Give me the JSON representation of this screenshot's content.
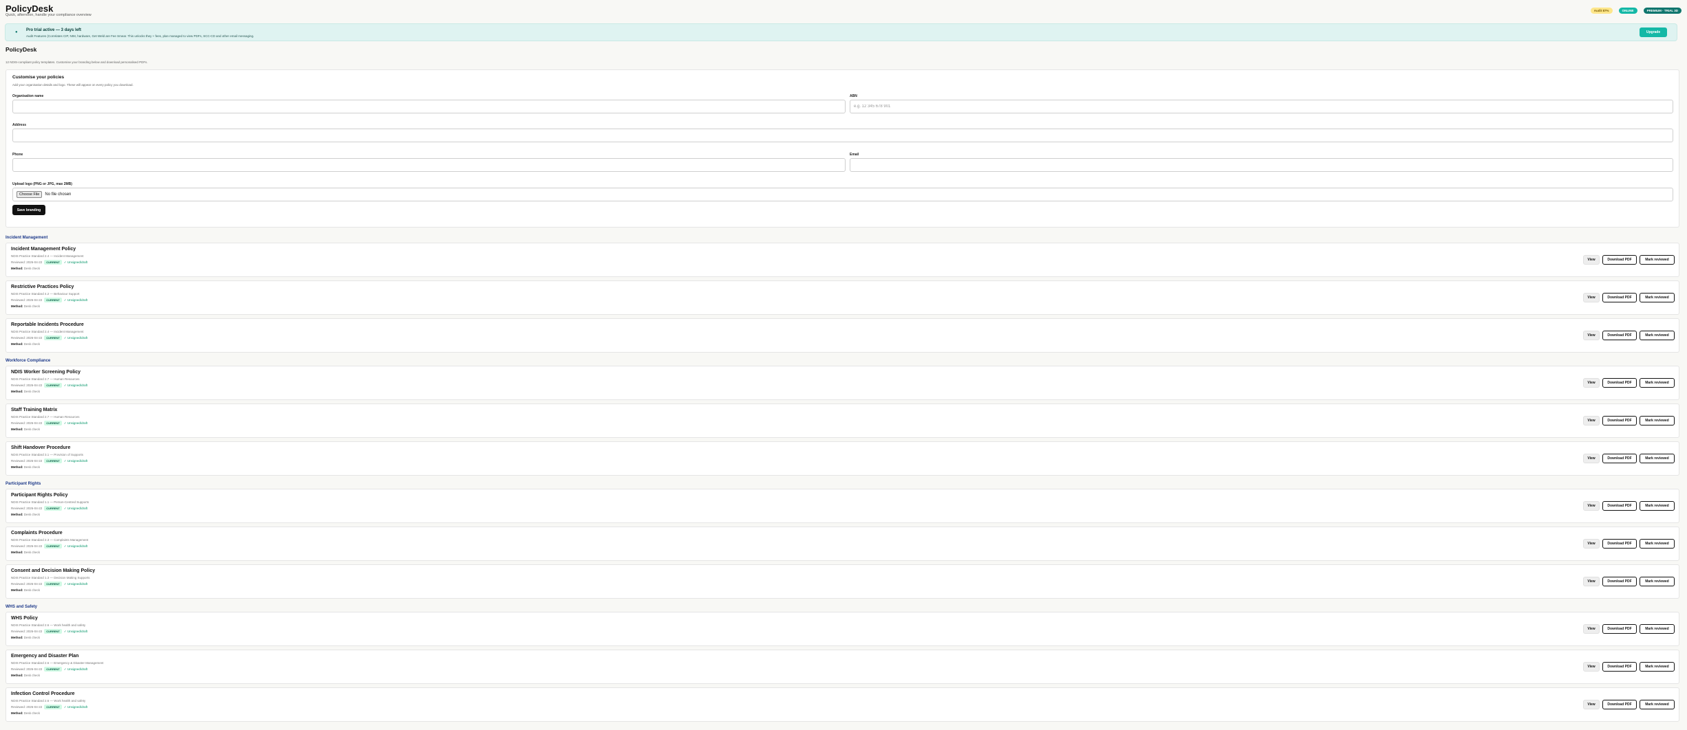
{
  "app": {
    "title": "PolicyDesk",
    "subtitle": "Quick, afternoon, handle your compliance overview",
    "badges": {
      "audit": "Audit 87%",
      "online": "ONLINE",
      "trial": "PREMIUM · TRIAL 3D"
    }
  },
  "trial_banner": {
    "icon": "bell-icon",
    "title": "Pro trial active — 3 days left",
    "text": "Audit Features (Correlates CIP, NIM, hardware, Get Weld are Fee Smear. This unlocks they + fees, plan managed to view PDFs, SCC-CD and other email messaging.",
    "upgrade_label": "Upgrade"
  },
  "page": {
    "title": "PolicyDesk",
    "subtitle": "12 NDIS-compliant policy templates. Customise your branding below and download personalised PDFs."
  },
  "branding": {
    "title": "Customise your policies",
    "description": "Add your organisation details and logo. These will appear on every policy you download.",
    "fields": {
      "org_name": {
        "label": "Organisation name",
        "value": "",
        "placeholder": ""
      },
      "abn": {
        "label": "ABN",
        "value": "",
        "placeholder": "e.g. 12 345 678 901"
      },
      "address": {
        "label": "Address",
        "value": "",
        "placeholder": ""
      },
      "phone": {
        "label": "Phone",
        "value": "",
        "placeholder": ""
      },
      "email": {
        "label": "Email",
        "value": "",
        "placeholder": ""
      }
    },
    "logo": {
      "label": "Upload logo (PNG or JPG, max 2MB)",
      "choose_label": "Choose File",
      "status": "No file chosen"
    },
    "save_label": "Save branding"
  },
  "actions": {
    "view": "View",
    "download": "Download PDF",
    "reviewed": "Mark reviewed"
  },
  "sections": [
    {
      "heading": "Incident Management",
      "policies": [
        {
          "title": "Incident Management Policy",
          "standard": "NDIS Practice Standard 2.4 — Incident Management",
          "reviewed": "Reviewed: 2026-04-22",
          "status": "CURRENT",
          "sign": "✓ Unsigned/draft",
          "method_label": "Method:",
          "method": "Desk check"
        },
        {
          "title": "Restrictive Practices Policy",
          "standard": "NDIS Practice Standard 4.2 — Behaviour Support",
          "reviewed": "Reviewed: 2026-04-22",
          "status": "CURRENT",
          "sign": "✓ Unsigned/draft",
          "method_label": "Method:",
          "method": "Desk check"
        },
        {
          "title": "Reportable Incidents Procedure",
          "standard": "NDIS Practice Standard 2.4 — Incident Management",
          "reviewed": "Reviewed: 2026-04-22",
          "status": "CURRENT",
          "sign": "✓ Unsigned/draft",
          "method_label": "Method:",
          "method": "Desk check"
        }
      ]
    },
    {
      "heading": "Workforce Compliance",
      "policies": [
        {
          "title": "NDIS Worker Screening Policy",
          "standard": "NDIS Practice Standard 2.7 — Human Resources",
          "reviewed": "Reviewed: 2026-04-22",
          "status": "CURRENT",
          "sign": "✓ Unsigned/draft",
          "method_label": "Method:",
          "method": "Desk check"
        },
        {
          "title": "Staff Training Matrix",
          "standard": "NDIS Practice Standard 2.7 — Human Resources",
          "reviewed": "Reviewed: 2026-04-22",
          "status": "CURRENT",
          "sign": "✓ Unsigned/draft",
          "method_label": "Method:",
          "method": "Desk check"
        },
        {
          "title": "Shift Handover Procedure",
          "standard": "NDIS Practice Standard 3.1 — Provision of Supports",
          "reviewed": "Reviewed: 2026-04-22",
          "status": "CURRENT",
          "sign": "✓ Unsigned/draft",
          "method_label": "Method:",
          "method": "Desk check"
        }
      ]
    },
    {
      "heading": "Participant Rights",
      "policies": [
        {
          "title": "Participant Rights Policy",
          "standard": "NDIS Practice Standard 1.1 — Person-Centred Supports",
          "reviewed": "Reviewed: 2026-04-22",
          "status": "CURRENT",
          "sign": "✓ Unsigned/draft",
          "method_label": "Method:",
          "method": "Desk check"
        },
        {
          "title": "Complaints Procedure",
          "standard": "NDIS Practice Standard 2.3 — Complaints Management",
          "reviewed": "Reviewed: 2026-04-22",
          "status": "CURRENT",
          "sign": "✓ Unsigned/draft",
          "method_label": "Method:",
          "method": "Desk check"
        },
        {
          "title": "Consent and Decision Making Policy",
          "standard": "NDIS Practice Standard 1.3 — Decision Making Supports",
          "reviewed": "Reviewed: 2026-04-22",
          "status": "CURRENT",
          "sign": "✓ Unsigned/draft",
          "method_label": "Method:",
          "method": "Desk check"
        }
      ]
    },
    {
      "heading": "WHS and Safety",
      "policies": [
        {
          "title": "WHS Policy",
          "standard": "NDIS Practice Standard 2.6 — Work health and safety",
          "reviewed": "Reviewed: 2026-04-22",
          "status": "CURRENT",
          "sign": "✓ Unsigned/draft",
          "method_label": "Method:",
          "method": "Desk check"
        },
        {
          "title": "Emergency and Disaster Plan",
          "standard": "NDIS Practice Standard 2.6 — Emergency & Disaster Management",
          "reviewed": "Reviewed: 2026-04-22",
          "status": "CURRENT",
          "sign": "✓ Unsigned/draft",
          "method_label": "Method:",
          "method": "Desk check"
        },
        {
          "title": "Infection Control Procedure",
          "standard": "NDIS Practice Standard 2.6 — Work health and safety",
          "reviewed": "Reviewed: 2026-04-22",
          "status": "CURRENT",
          "sign": "✓ Unsigned/draft",
          "method_label": "Method:",
          "method": "Desk check"
        }
      ]
    }
  ]
}
